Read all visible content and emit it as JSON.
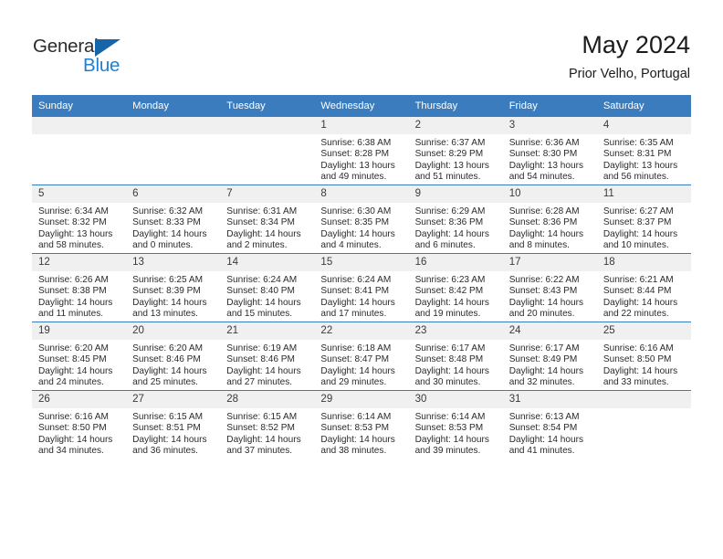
{
  "brand": {
    "name_top": "General",
    "name_bottom": "Blue",
    "accent_color": "#1f7fd0",
    "triangle_color": "#1565a8"
  },
  "header": {
    "title": "May 2024",
    "subtitle": "Prior Velho, Portugal"
  },
  "theme": {
    "header_row_bg": "#3a7cbe",
    "daynum_bg": "#f0f0f0",
    "text_color": "#2a2a2a",
    "page_bg": "#ffffff"
  },
  "columns": [
    "Sunday",
    "Monday",
    "Tuesday",
    "Wednesday",
    "Thursday",
    "Friday",
    "Saturday"
  ],
  "weeks": [
    [
      {
        "day": "",
        "empty": true
      },
      {
        "day": "",
        "empty": true
      },
      {
        "day": "",
        "empty": true
      },
      {
        "day": "1",
        "sunrise": "Sunrise: 6:38 AM",
        "sunset": "Sunset: 8:28 PM",
        "daylight": "Daylight: 13 hours and 49 minutes."
      },
      {
        "day": "2",
        "sunrise": "Sunrise: 6:37 AM",
        "sunset": "Sunset: 8:29 PM",
        "daylight": "Daylight: 13 hours and 51 minutes."
      },
      {
        "day": "3",
        "sunrise": "Sunrise: 6:36 AM",
        "sunset": "Sunset: 8:30 PM",
        "daylight": "Daylight: 13 hours and 54 minutes."
      },
      {
        "day": "4",
        "sunrise": "Sunrise: 6:35 AM",
        "sunset": "Sunset: 8:31 PM",
        "daylight": "Daylight: 13 hours and 56 minutes."
      }
    ],
    [
      {
        "day": "5",
        "sunrise": "Sunrise: 6:34 AM",
        "sunset": "Sunset: 8:32 PM",
        "daylight": "Daylight: 13 hours and 58 minutes."
      },
      {
        "day": "6",
        "sunrise": "Sunrise: 6:32 AM",
        "sunset": "Sunset: 8:33 PM",
        "daylight": "Daylight: 14 hours and 0 minutes."
      },
      {
        "day": "7",
        "sunrise": "Sunrise: 6:31 AM",
        "sunset": "Sunset: 8:34 PM",
        "daylight": "Daylight: 14 hours and 2 minutes."
      },
      {
        "day": "8",
        "sunrise": "Sunrise: 6:30 AM",
        "sunset": "Sunset: 8:35 PM",
        "daylight": "Daylight: 14 hours and 4 minutes."
      },
      {
        "day": "9",
        "sunrise": "Sunrise: 6:29 AM",
        "sunset": "Sunset: 8:36 PM",
        "daylight": "Daylight: 14 hours and 6 minutes."
      },
      {
        "day": "10",
        "sunrise": "Sunrise: 6:28 AM",
        "sunset": "Sunset: 8:36 PM",
        "daylight": "Daylight: 14 hours and 8 minutes."
      },
      {
        "day": "11",
        "sunrise": "Sunrise: 6:27 AM",
        "sunset": "Sunset: 8:37 PM",
        "daylight": "Daylight: 14 hours and 10 minutes."
      }
    ],
    [
      {
        "day": "12",
        "sunrise": "Sunrise: 6:26 AM",
        "sunset": "Sunset: 8:38 PM",
        "daylight": "Daylight: 14 hours and 11 minutes."
      },
      {
        "day": "13",
        "sunrise": "Sunrise: 6:25 AM",
        "sunset": "Sunset: 8:39 PM",
        "daylight": "Daylight: 14 hours and 13 minutes."
      },
      {
        "day": "14",
        "sunrise": "Sunrise: 6:24 AM",
        "sunset": "Sunset: 8:40 PM",
        "daylight": "Daylight: 14 hours and 15 minutes."
      },
      {
        "day": "15",
        "sunrise": "Sunrise: 6:24 AM",
        "sunset": "Sunset: 8:41 PM",
        "daylight": "Daylight: 14 hours and 17 minutes."
      },
      {
        "day": "16",
        "sunrise": "Sunrise: 6:23 AM",
        "sunset": "Sunset: 8:42 PM",
        "daylight": "Daylight: 14 hours and 19 minutes."
      },
      {
        "day": "17",
        "sunrise": "Sunrise: 6:22 AM",
        "sunset": "Sunset: 8:43 PM",
        "daylight": "Daylight: 14 hours and 20 minutes."
      },
      {
        "day": "18",
        "sunrise": "Sunrise: 6:21 AM",
        "sunset": "Sunset: 8:44 PM",
        "daylight": "Daylight: 14 hours and 22 minutes."
      }
    ],
    [
      {
        "day": "19",
        "sunrise": "Sunrise: 6:20 AM",
        "sunset": "Sunset: 8:45 PM",
        "daylight": "Daylight: 14 hours and 24 minutes."
      },
      {
        "day": "20",
        "sunrise": "Sunrise: 6:20 AM",
        "sunset": "Sunset: 8:46 PM",
        "daylight": "Daylight: 14 hours and 25 minutes."
      },
      {
        "day": "21",
        "sunrise": "Sunrise: 6:19 AM",
        "sunset": "Sunset: 8:46 PM",
        "daylight": "Daylight: 14 hours and 27 minutes."
      },
      {
        "day": "22",
        "sunrise": "Sunrise: 6:18 AM",
        "sunset": "Sunset: 8:47 PM",
        "daylight": "Daylight: 14 hours and 29 minutes."
      },
      {
        "day": "23",
        "sunrise": "Sunrise: 6:17 AM",
        "sunset": "Sunset: 8:48 PM",
        "daylight": "Daylight: 14 hours and 30 minutes."
      },
      {
        "day": "24",
        "sunrise": "Sunrise: 6:17 AM",
        "sunset": "Sunset: 8:49 PM",
        "daylight": "Daylight: 14 hours and 32 minutes."
      },
      {
        "day": "25",
        "sunrise": "Sunrise: 6:16 AM",
        "sunset": "Sunset: 8:50 PM",
        "daylight": "Daylight: 14 hours and 33 minutes."
      }
    ],
    [
      {
        "day": "26",
        "sunrise": "Sunrise: 6:16 AM",
        "sunset": "Sunset: 8:50 PM",
        "daylight": "Daylight: 14 hours and 34 minutes."
      },
      {
        "day": "27",
        "sunrise": "Sunrise: 6:15 AM",
        "sunset": "Sunset: 8:51 PM",
        "daylight": "Daylight: 14 hours and 36 minutes."
      },
      {
        "day": "28",
        "sunrise": "Sunrise: 6:15 AM",
        "sunset": "Sunset: 8:52 PM",
        "daylight": "Daylight: 14 hours and 37 minutes."
      },
      {
        "day": "29",
        "sunrise": "Sunrise: 6:14 AM",
        "sunset": "Sunset: 8:53 PM",
        "daylight": "Daylight: 14 hours and 38 minutes."
      },
      {
        "day": "30",
        "sunrise": "Sunrise: 6:14 AM",
        "sunset": "Sunset: 8:53 PM",
        "daylight": "Daylight: 14 hours and 39 minutes."
      },
      {
        "day": "31",
        "sunrise": "Sunrise: 6:13 AM",
        "sunset": "Sunset: 8:54 PM",
        "daylight": "Daylight: 14 hours and 41 minutes."
      },
      {
        "day": "",
        "empty": true
      }
    ]
  ]
}
